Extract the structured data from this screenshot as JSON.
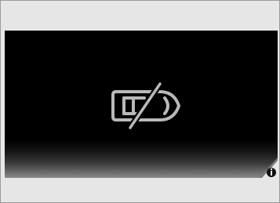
{
  "display": {
    "warning_icon": "vehicle-system-off-icon",
    "info_icon": "info-icon",
    "colors": {
      "screen_background": "#000000",
      "icon_stroke": "#b9b9b9",
      "frame_band": "#e6e6e6",
      "info_badge": "#e8e8e8"
    }
  }
}
